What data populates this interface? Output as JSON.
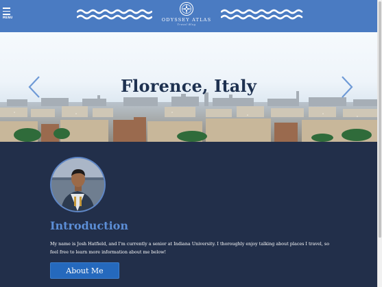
{
  "header": {
    "menu_label": "MENU",
    "brand_name": "ODYSSEY ATLAS",
    "brand_tagline": "Travel Blog",
    "background_color": "#4a7bc2"
  },
  "hero": {
    "title": "Florence, Italy",
    "prev_icon": "chevron-left-icon",
    "next_icon": "chevron-right-icon"
  },
  "intro": {
    "heading": "Introduction",
    "body": "My name is Josh Hatfield, and I'm currently a senior at Indiana University. I thoroughly enjoy talking about places I travel, so feel free to learn more information about me below!",
    "button_label": "About Me",
    "accent_color": "#5c8ed6",
    "button_color": "#2569bd",
    "section_background": "#222f4a"
  }
}
